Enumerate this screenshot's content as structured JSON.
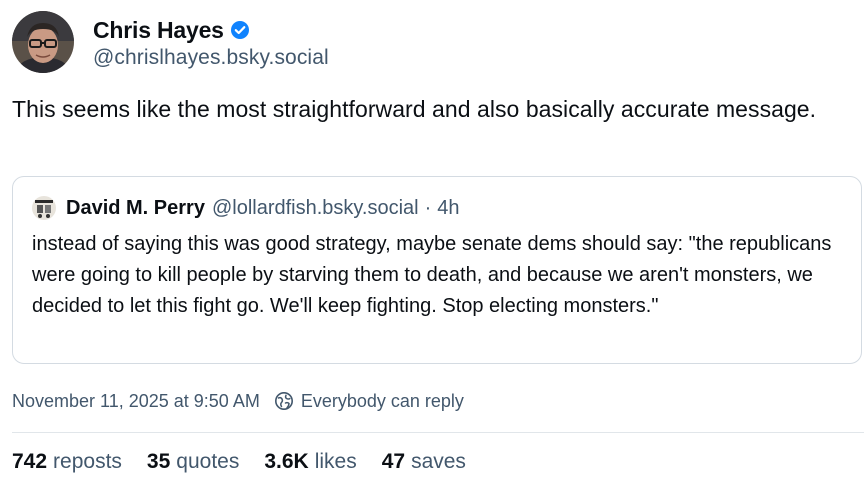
{
  "author": {
    "display_name": "Chris Hayes",
    "handle": "@chrislhayes.bsky.social",
    "verified": true,
    "verified_color": "#1083fe"
  },
  "post": {
    "text": "This seems like the most straightforward and also basically accurate message."
  },
  "quoted_post": {
    "author_name": "David M. Perry",
    "author_handle": "@lollardfish.bsky.social",
    "separator": "·",
    "time": "4h",
    "text": "instead of saying this was good strategy, maybe senate dems should say: \"the republicans were going to kill people by starving them to death, and because we aren't monsters, we decided to let this fight go. We'll keep fighting. Stop electing monsters.\""
  },
  "meta": {
    "timestamp": "November 11, 2025 at 9:50 AM",
    "reply_setting": "Everybody can reply",
    "reply_icon": "globe-icon"
  },
  "stats": [
    {
      "count": "742",
      "label": "reposts"
    },
    {
      "count": "35",
      "label": "quotes"
    },
    {
      "count": "3.6K",
      "label": "likes"
    },
    {
      "count": "47",
      "label": "saves"
    }
  ],
  "colors": {
    "text": "#0b0f14",
    "secondary": "#42576c",
    "border": "#d4dbe2"
  }
}
